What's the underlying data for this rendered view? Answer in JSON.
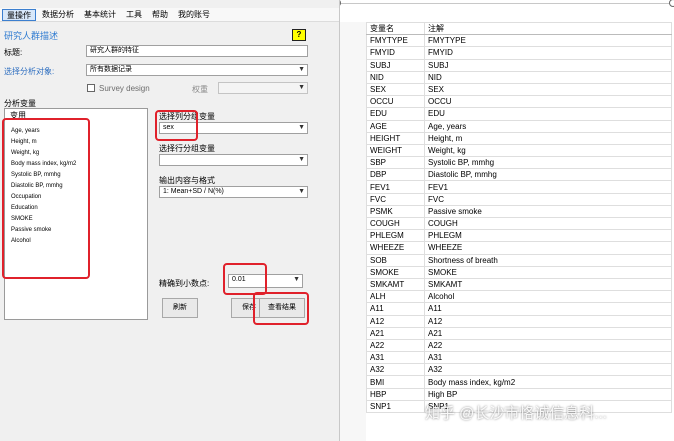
{
  "menu": [
    "量操作",
    "数据分析",
    "基本统计",
    "工具",
    "帮助",
    "我的账号"
  ],
  "dialog": {
    "title": "研究人群描述",
    "help_label": "?",
    "title_label": "标题:",
    "title_value": "研究人群的特征",
    "subset_label": "选择分析对象:",
    "subset_value": "所有数据记录",
    "survey_label": "Survey design",
    "weight_label": "权重",
    "analysis_vars_label": "分析变量",
    "var_list_header": "变用",
    "variables": [
      "Age, years",
      "Height, m",
      "Weight, kg",
      "Body mass index, kg/m2",
      "Systolic BP, mmhg",
      "Diastolic BP, mmhg",
      "Occupation",
      "Education",
      "SMOKE",
      "Passive smoke",
      "Alcohol"
    ],
    "col_group_label": "选择列分组变量",
    "col_group_value": "sex",
    "row_group_label": "选择行分组变量",
    "row_group_value": "",
    "output_label": "输出内容与格式",
    "output_value": "1: Mean+SD / N(%)",
    "decimals_label": "精确到小数点:",
    "decimals_value": "0.01",
    "refresh_label": "刷新",
    "save_label": "保存",
    "view_label": "查看结果"
  },
  "table": {
    "headers": [
      "变量名",
      "注解"
    ],
    "rows": [
      [
        "FMYTYPE",
        "FMYTYPE"
      ],
      [
        "FMYID",
        "FMYID"
      ],
      [
        "SUBJ",
        "SUBJ"
      ],
      [
        "NID",
        "NID"
      ],
      [
        "SEX",
        "SEX"
      ],
      [
        "OCCU",
        "OCCU"
      ],
      [
        "EDU",
        "EDU"
      ],
      [
        "AGE",
        "Age, years"
      ],
      [
        "HEIGHT",
        "Height, m"
      ],
      [
        "WEIGHT",
        "Weight, kg"
      ],
      [
        "SBP",
        "Systolic BP, mmhg"
      ],
      [
        "DBP",
        "Diastolic BP, mmhg"
      ],
      [
        "FEV1",
        "FEV1"
      ],
      [
        "FVC",
        "FVC"
      ],
      [
        "PSMK",
        "Passive smoke"
      ],
      [
        "COUGH",
        "COUGH"
      ],
      [
        "PHLEGM",
        "PHLEGM"
      ],
      [
        "WHEEZE",
        "WHEEZE"
      ],
      [
        "SOB",
        "Shortness of breath"
      ],
      [
        "SMOKE",
        "SMOKE"
      ],
      [
        "SMKAMT",
        "SMKAMT"
      ],
      [
        "ALH",
        "Alcohol"
      ],
      [
        "A11",
        "A11"
      ],
      [
        "A12",
        "A12"
      ],
      [
        "A21",
        "A21"
      ],
      [
        "A22",
        "A22"
      ],
      [
        "A31",
        "A31"
      ],
      [
        "A32",
        "A32"
      ],
      [
        "BMI",
        "Body mass index, kg/m2"
      ],
      [
        "HBP",
        "High BP"
      ],
      [
        "SNP1",
        "SNP1"
      ]
    ]
  },
  "watermark": "知乎 @长沙市恪诚信息科..."
}
